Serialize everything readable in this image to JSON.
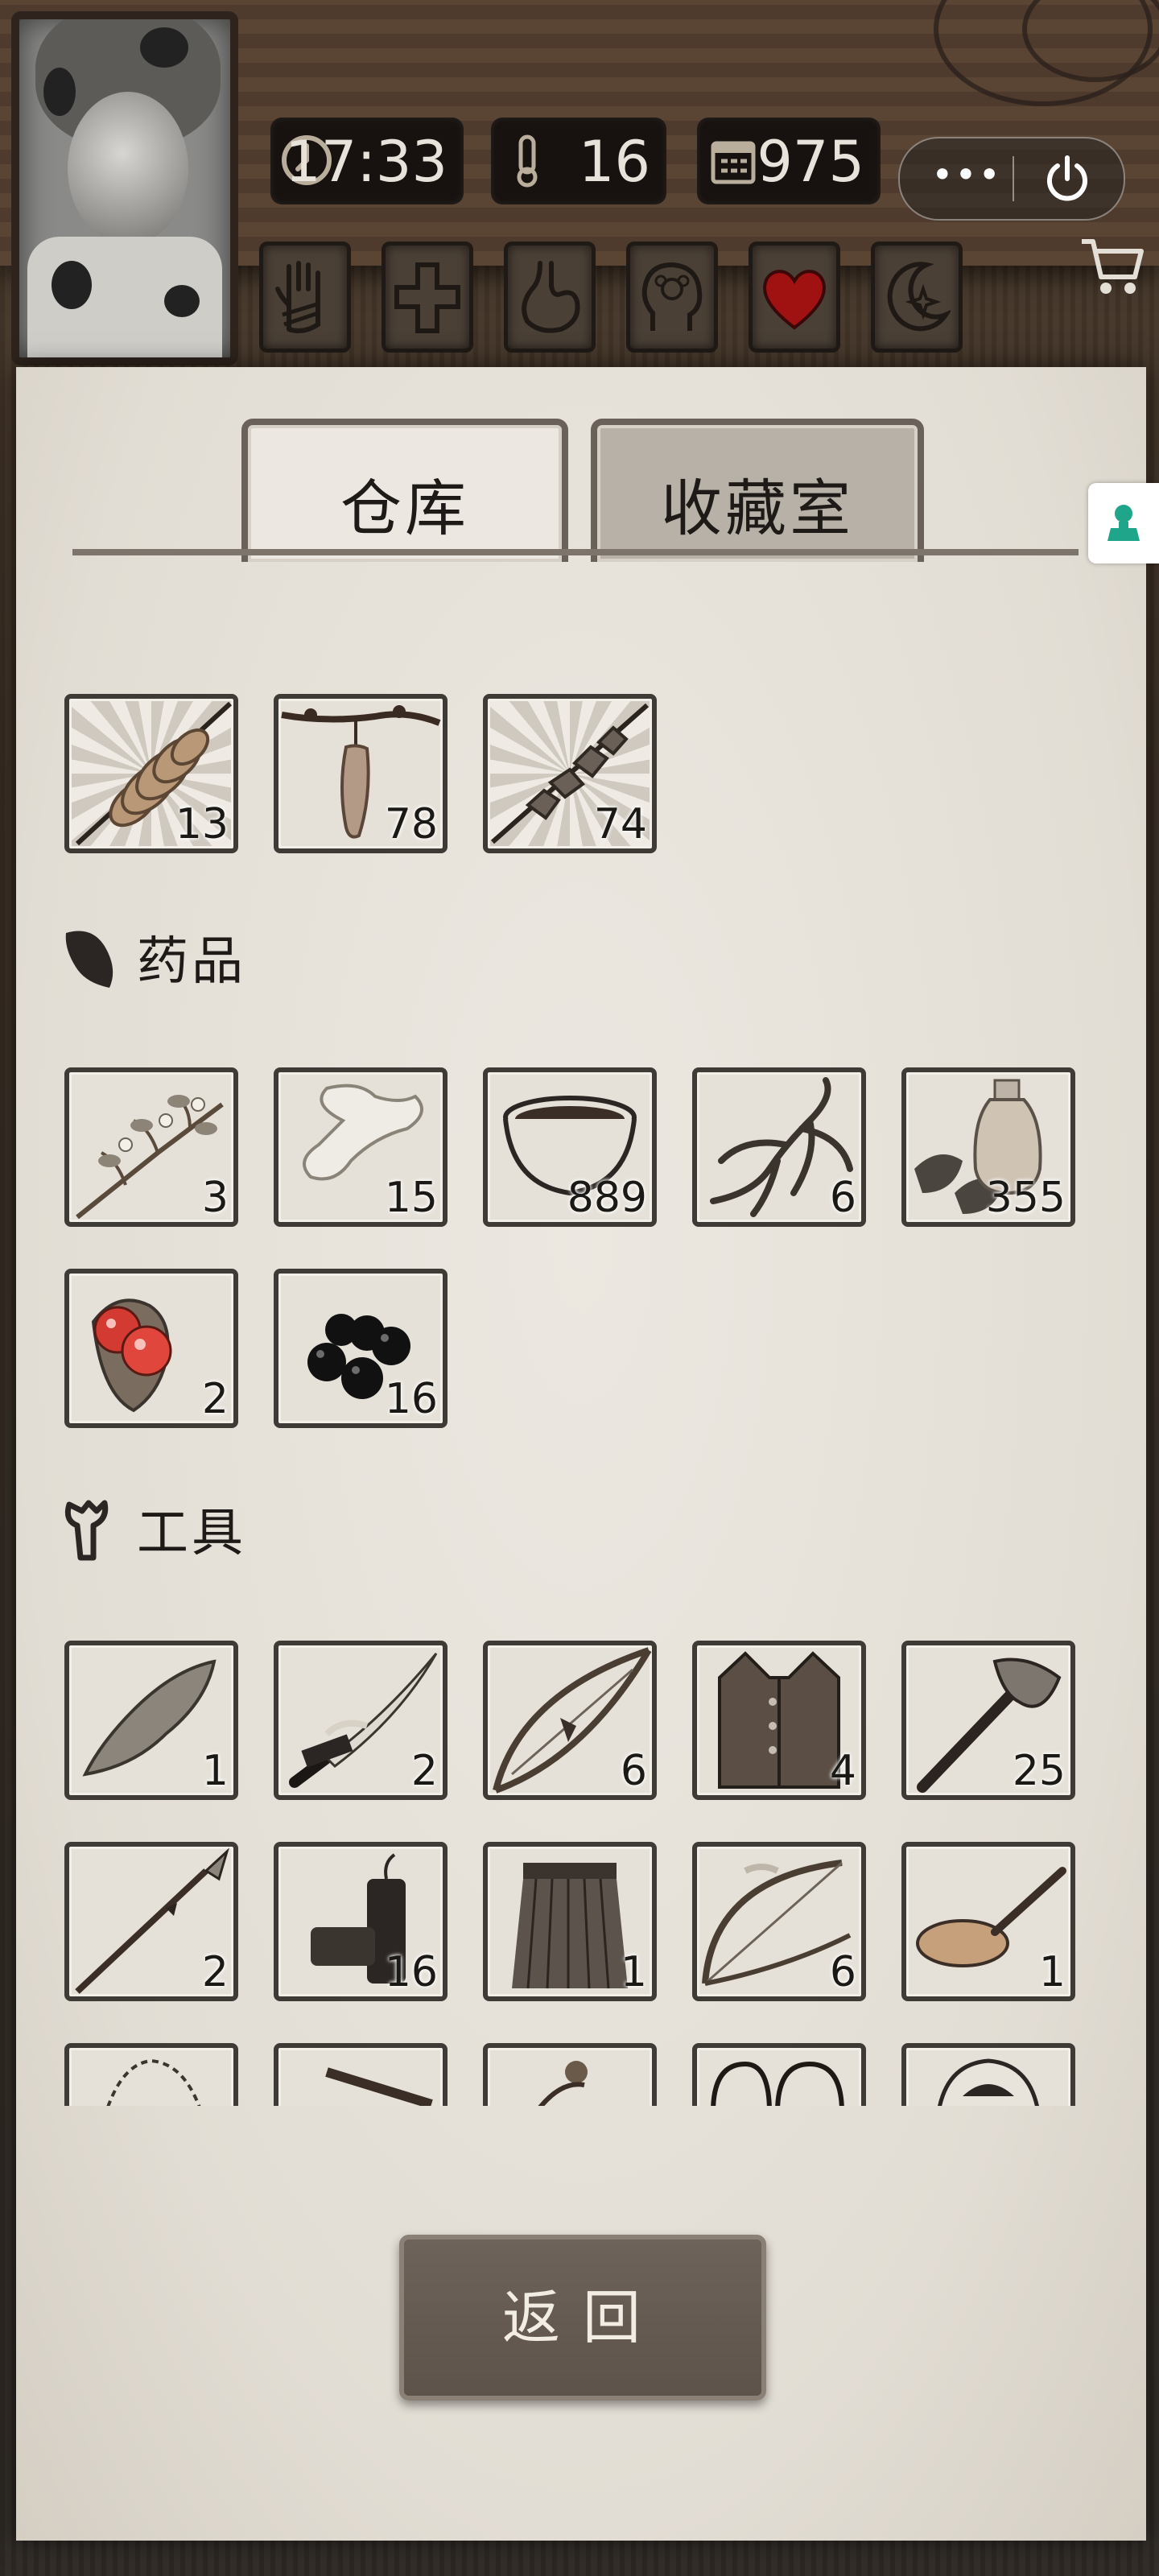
{
  "status": {
    "time": "17:33",
    "temperature": "16",
    "day": "975"
  },
  "capsule": {
    "more": "•••"
  },
  "stats": [
    {
      "name": "hand"
    },
    {
      "name": "cross"
    },
    {
      "name": "stomach"
    },
    {
      "name": "head"
    },
    {
      "name": "heart",
      "color": "#a01212"
    },
    {
      "name": "moon"
    }
  ],
  "tabs": [
    {
      "label": "仓库",
      "active": true
    },
    {
      "label": "收藏室",
      "active": false
    }
  ],
  "food_items": [
    {
      "icon": "roasted-larvae-icon",
      "count": "13"
    },
    {
      "icon": "hanging-meat-icon",
      "count": "78"
    },
    {
      "icon": "meat-skewer-icon",
      "count": "74"
    }
  ],
  "medicine_section": {
    "label": "药品",
    "icon": "leaf-icon"
  },
  "medicine_items": [
    {
      "icon": "herb-branch-icon",
      "count": "3"
    },
    {
      "icon": "bandage-icon",
      "count": "15"
    },
    {
      "icon": "herbal-soup-bowl-icon",
      "count": "889"
    },
    {
      "icon": "ginseng-root-icon",
      "count": "6"
    },
    {
      "icon": "medicine-bottle-icon",
      "count": "355"
    },
    {
      "icon": "red-berries-icon",
      "count": "2"
    },
    {
      "icon": "black-berries-icon",
      "count": "16"
    }
  ],
  "tools_section": {
    "label": "工具",
    "icon": "wrench-icon"
  },
  "tool_items": [
    {
      "icon": "stone-blade-icon",
      "count": "1"
    },
    {
      "icon": "katana-icon",
      "count": "2"
    },
    {
      "icon": "bow-icon",
      "count": "6"
    },
    {
      "icon": "leather-vest-icon",
      "count": "4"
    },
    {
      "icon": "stone-axe-icon",
      "count": "25"
    },
    {
      "icon": "spear-icon",
      "count": "2"
    },
    {
      "icon": "firecracker-icon",
      "count": "16"
    },
    {
      "icon": "grass-skirt-icon",
      "count": "1"
    },
    {
      "icon": "longbow-icon",
      "count": "6"
    },
    {
      "icon": "frying-pan-icon",
      "count": "1"
    },
    {
      "icon": "rope-icon",
      "count": ""
    },
    {
      "icon": "rifle-icon",
      "count": ""
    },
    {
      "icon": "gourd-icon",
      "count": ""
    },
    {
      "icon": "whip-icon",
      "count": ""
    },
    {
      "icon": "fur-hat-icon",
      "count": ""
    }
  ],
  "back_button": {
    "label": "返回"
  }
}
